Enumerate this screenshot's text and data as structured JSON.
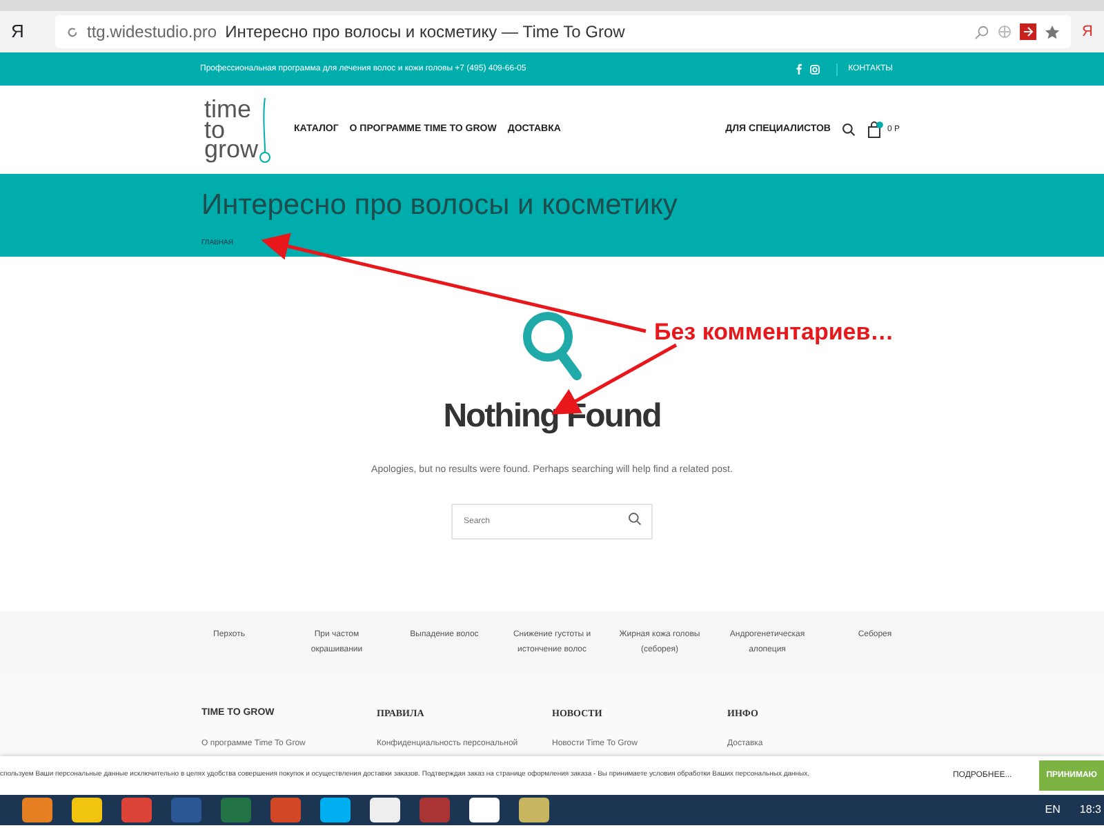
{
  "browser": {
    "logo": "Я",
    "url": "ttg.widestudio.pro",
    "page_title": "Интересно про волосы и косметику — Time To Grow",
    "profile": "Я"
  },
  "topbar": {
    "text": "Профессиональная программа для лечения волос и кожи головы +7 (495) 409-66-05",
    "link": "КОНТАКТЫ"
  },
  "header": {
    "logo": [
      "time",
      "to",
      "grow"
    ],
    "nav": [
      "КАТАЛОГ",
      "О ПРОГРАММЕ TIME TO GROW",
      "ДОСТАВКА"
    ],
    "specialists": "ДЛЯ СПЕЦИАЛИСТОВ",
    "cart_total": "0 Р"
  },
  "title_band": {
    "title": "Интересно про волосы и косметику",
    "breadcrumb": "ГЛАВНАЯ"
  },
  "content": {
    "heading": "Nothing Found",
    "message": "Apologies, but no results were found. Perhaps searching will help find a related post.",
    "search": {
      "placeholder": "Search"
    }
  },
  "categories": [
    "Перхоть",
    "При частом окрашивании",
    "Выпадение волос",
    "Снижение густоты и истончение волос",
    "Жирная кожа головы (себорея)",
    "Андрогенетическая алопеция",
    "Себорея"
  ],
  "footer_columns": [
    {
      "heading": "TIME TO GROW",
      "link": "О программе Time To Grow"
    },
    {
      "heading": "ПРАВИЛА",
      "link": "Конфиденциальность персональной"
    },
    {
      "heading": "НОВОСТИ",
      "link": "Новости Time To Grow"
    },
    {
      "heading": "ИНФО",
      "link": "Доставка"
    }
  ],
  "cookie_bar": {
    "text": "спользуем Ваши персональные данные исключительно в целях удобства совершения покупок и осуществления доставки заказов. Подтверждая заказ на странице оформления заказа - Вы принимаете условия обработки Ваших персональных данных.",
    "more": "ПОДРОБНЕЕ...",
    "accept": "ПРИНИМАЮ"
  },
  "annotation": {
    "text": "Без комментариев…"
  },
  "taskbar": {
    "language": "EN",
    "clock": "18:3"
  }
}
